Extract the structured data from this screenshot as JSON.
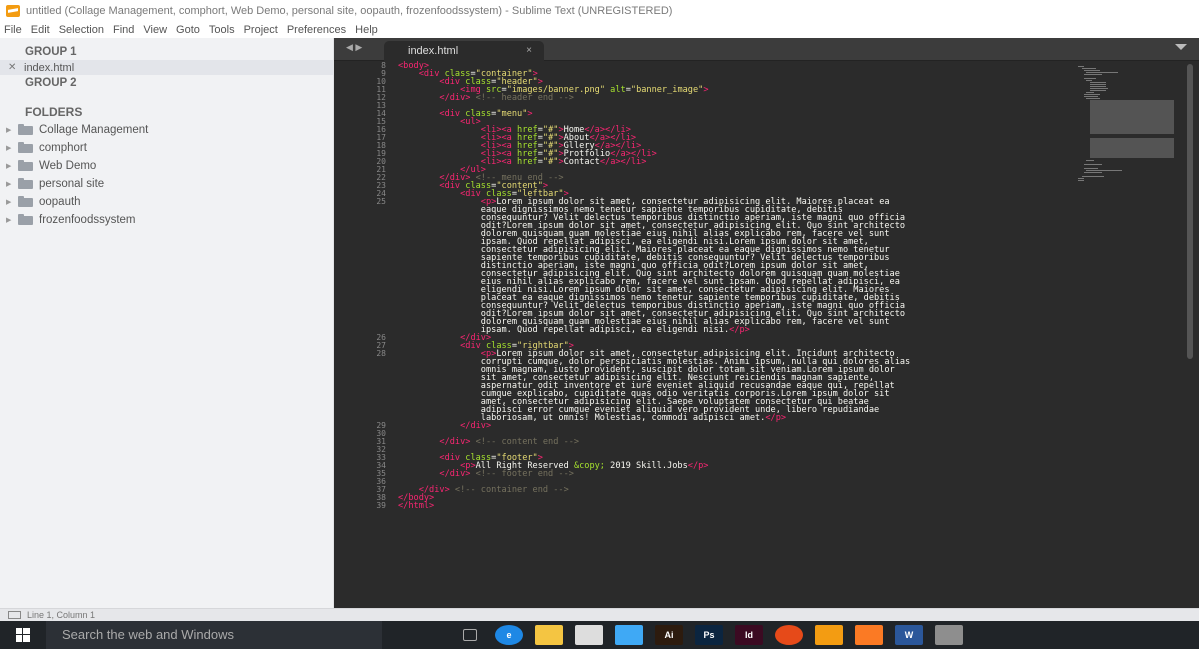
{
  "titlebar": {
    "text": "untitled (Collage Management, comphort, Web Demo, personal site, oopauth, frozenfoodssystem) - Sublime Text (UNREGISTERED)"
  },
  "menu": [
    "File",
    "Edit",
    "Selection",
    "Find",
    "View",
    "Goto",
    "Tools",
    "Project",
    "Preferences",
    "Help"
  ],
  "sidebar": {
    "group1": "GROUP 1",
    "open_file": "index.html",
    "group2": "GROUP 2",
    "folders_title": "FOLDERS",
    "folders": [
      "Collage Management",
      "comphort",
      "Web Demo",
      "personal site",
      "oopauth",
      "frozenfoodssystem"
    ]
  },
  "tab": {
    "nav": "◀ ▶",
    "title": "index.html",
    "close": "×"
  },
  "editor": {
    "lines": [
      {
        "n": "8",
        "t": [
          [
            "t",
            "<body>"
          ]
        ]
      },
      {
        "n": "9",
        "t": [
          [
            "p",
            "    "
          ],
          [
            "t",
            "<div"
          ],
          [
            "a",
            " class"
          ],
          [
            "p",
            "="
          ],
          [
            "s",
            "\"container\""
          ],
          [
            "t",
            ">"
          ]
        ]
      },
      {
        "n": "10",
        "t": [
          [
            "p",
            "        "
          ],
          [
            "t",
            "<div"
          ],
          [
            "a",
            " class"
          ],
          [
            "p",
            "="
          ],
          [
            "s",
            "\"header\""
          ],
          [
            "t",
            ">"
          ]
        ]
      },
      {
        "n": "11",
        "t": [
          [
            "p",
            "            "
          ],
          [
            "t",
            "<img"
          ],
          [
            "a",
            " src"
          ],
          [
            "p",
            "="
          ],
          [
            "s",
            "\"images/banner.png\""
          ],
          [
            "a",
            " alt"
          ],
          [
            "p",
            "="
          ],
          [
            "s",
            "\"banner_image\""
          ],
          [
            "t",
            ">"
          ]
        ]
      },
      {
        "n": "12",
        "t": [
          [
            "p",
            "        "
          ],
          [
            "t",
            "</div>"
          ],
          [
            "c",
            " <!-- header end -->"
          ]
        ]
      },
      {
        "n": "13",
        "t": []
      },
      {
        "n": "14",
        "t": [
          [
            "p",
            "        "
          ],
          [
            "t",
            "<div"
          ],
          [
            "a",
            " class"
          ],
          [
            "p",
            "="
          ],
          [
            "s",
            "\"menu\""
          ],
          [
            "t",
            ">"
          ]
        ]
      },
      {
        "n": "15",
        "t": [
          [
            "p",
            "            "
          ],
          [
            "t",
            "<ul>"
          ]
        ]
      },
      {
        "n": "16",
        "t": [
          [
            "p",
            "                "
          ],
          [
            "t",
            "<li><a"
          ],
          [
            "a",
            " href"
          ],
          [
            "p",
            "="
          ],
          [
            "s",
            "\"#\""
          ],
          [
            "t",
            ">"
          ],
          [
            "p",
            "Home"
          ],
          [
            "t",
            "</a></li>"
          ]
        ]
      },
      {
        "n": "17",
        "t": [
          [
            "p",
            "                "
          ],
          [
            "t",
            "<li><a"
          ],
          [
            "a",
            " href"
          ],
          [
            "p",
            "="
          ],
          [
            "s",
            "\"#\""
          ],
          [
            "t",
            ">"
          ],
          [
            "p",
            "About"
          ],
          [
            "t",
            "</a></li>"
          ]
        ]
      },
      {
        "n": "18",
        "t": [
          [
            "p",
            "                "
          ],
          [
            "t",
            "<li><a"
          ],
          [
            "a",
            " href"
          ],
          [
            "p",
            "="
          ],
          [
            "s",
            "\"#\""
          ],
          [
            "t",
            ">"
          ],
          [
            "p",
            "Gllery"
          ],
          [
            "t",
            "</a></li>"
          ]
        ]
      },
      {
        "n": "19",
        "t": [
          [
            "p",
            "                "
          ],
          [
            "t",
            "<li><a"
          ],
          [
            "a",
            " href"
          ],
          [
            "p",
            "="
          ],
          [
            "s",
            "\"#\""
          ],
          [
            "t",
            ">"
          ],
          [
            "p",
            "Protfolio"
          ],
          [
            "t",
            "</a></li>"
          ]
        ]
      },
      {
        "n": "20",
        "t": [
          [
            "p",
            "                "
          ],
          [
            "t",
            "<li><a"
          ],
          [
            "a",
            " href"
          ],
          [
            "p",
            "="
          ],
          [
            "s",
            "\"#\""
          ],
          [
            "t",
            ">"
          ],
          [
            "p",
            "Contact"
          ],
          [
            "t",
            "</a></li>"
          ]
        ]
      },
      {
        "n": "21",
        "t": [
          [
            "p",
            "            "
          ],
          [
            "t",
            "</ul>"
          ]
        ]
      },
      {
        "n": "22",
        "t": [
          [
            "p",
            "        "
          ],
          [
            "t",
            "</div>"
          ],
          [
            "c",
            " <!-- menu end -->"
          ]
        ]
      },
      {
        "n": "23",
        "t": [
          [
            "p",
            "        "
          ],
          [
            "t",
            "<div"
          ],
          [
            "a",
            " class"
          ],
          [
            "p",
            "="
          ],
          [
            "s",
            "\"content\""
          ],
          [
            "t",
            ">"
          ]
        ]
      },
      {
        "n": "24",
        "t": [
          [
            "p",
            "            "
          ],
          [
            "t",
            "<div"
          ],
          [
            "a",
            " class"
          ],
          [
            "p",
            "="
          ],
          [
            "s",
            "\"leftbar\""
          ],
          [
            "t",
            ">"
          ]
        ]
      },
      {
        "n": "25",
        "t": [
          [
            "p",
            "                "
          ],
          [
            "t",
            "<p>"
          ],
          [
            "p",
            "Lorem ipsum dolor sit amet, consectetur adipisicing elit. Maiores placeat ea"
          ]
        ]
      },
      {
        "n": "",
        "t": [
          [
            "p",
            "                eaque dignissimos nemo tenetur sapiente temporibus cupiditate, debitis"
          ]
        ]
      },
      {
        "n": "",
        "t": [
          [
            "p",
            "                consequuntur? Velit delectus temporibus distinctio aperiam, iste magni quo officia"
          ]
        ]
      },
      {
        "n": "",
        "t": [
          [
            "p",
            "                odit?Lorem ipsum dolor sit amet, consectetur adipisicing elit. Quo sint architecto"
          ]
        ]
      },
      {
        "n": "",
        "t": [
          [
            "p",
            "                dolorem quisquam quam molestiae eius nihil alias explicabo rem, facere vel sunt"
          ]
        ]
      },
      {
        "n": "",
        "t": [
          [
            "p",
            "                ipsam. Quod repellat adipisci, ea eligendi nisi.Lorem ipsum dolor sit amet,"
          ]
        ]
      },
      {
        "n": "",
        "t": [
          [
            "p",
            "                consectetur adipisicing elit. Maiores placeat ea eaque dignissimos nemo tenetur"
          ]
        ]
      },
      {
        "n": "",
        "t": [
          [
            "p",
            "                sapiente temporibus cupiditate, debitis consequuntur? Velit delectus temporibus"
          ]
        ]
      },
      {
        "n": "",
        "t": [
          [
            "p",
            "                distinctio aperiam, iste magni quo officia odit?Lorem ipsum dolor sit amet,"
          ]
        ]
      },
      {
        "n": "",
        "t": [
          [
            "p",
            "                consectetur adipisicing elit. Quo sint architecto dolorem quisquam quam molestiae"
          ]
        ]
      },
      {
        "n": "",
        "t": [
          [
            "p",
            "                eius nihil alias explicabo rem, facere vel sunt ipsam. Quod repellat adipisci, ea"
          ]
        ]
      },
      {
        "n": "",
        "t": [
          [
            "p",
            "                eligendi nisi.Lorem ipsum dolor sit amet, consectetur adipisicing elit. Maiores"
          ]
        ]
      },
      {
        "n": "",
        "t": [
          [
            "p",
            "                placeat ea eaque dignissimos nemo tenetur sapiente temporibus cupiditate, debitis"
          ]
        ]
      },
      {
        "n": "",
        "t": [
          [
            "p",
            "                consequuntur? Velit delectus temporibus distinctio aperiam, iste magni quo officia"
          ]
        ]
      },
      {
        "n": "",
        "t": [
          [
            "p",
            "                odit?Lorem ipsum dolor sit amet, consectetur adipisicing elit. Quo sint architecto"
          ]
        ]
      },
      {
        "n": "",
        "t": [
          [
            "p",
            "                dolorem quisquam quam molestiae eius nihil alias explicabo rem, facere vel sunt"
          ]
        ]
      },
      {
        "n": "",
        "t": [
          [
            "p",
            "                ipsam. Quod repellat adipisci, ea eligendi nisi."
          ],
          [
            "t",
            "</p>"
          ]
        ]
      },
      {
        "n": "26",
        "t": [
          [
            "p",
            "            "
          ],
          [
            "t",
            "</div>"
          ]
        ]
      },
      {
        "n": "27",
        "t": [
          [
            "p",
            "            "
          ],
          [
            "t",
            "<div"
          ],
          [
            "a",
            " class"
          ],
          [
            "p",
            "="
          ],
          [
            "s",
            "\"rightbar\""
          ],
          [
            "t",
            ">"
          ]
        ]
      },
      {
        "n": "28",
        "t": [
          [
            "p",
            "                "
          ],
          [
            "t",
            "<p>"
          ],
          [
            "p",
            "Lorem ipsum dolor sit amet, consectetur adipisicing elit. Incidunt architecto"
          ]
        ]
      },
      {
        "n": "",
        "t": [
          [
            "p",
            "                corrupti cumque, dolor perspiciatis molestias. Animi ipsum, nulla qui dolores alias"
          ]
        ]
      },
      {
        "n": "",
        "t": [
          [
            "p",
            "                omnis magnam, iusto provident, suscipit dolor totam sit veniam.Lorem ipsum dolor"
          ]
        ]
      },
      {
        "n": "",
        "t": [
          [
            "p",
            "                sit amet, consectetur adipisicing elit. Nesciunt reiciendis magnam sapiente,"
          ]
        ]
      },
      {
        "n": "",
        "t": [
          [
            "p",
            "                aspernatur odit inventore et iure eveniet aliquid recusandae eaque qui, repellat"
          ]
        ]
      },
      {
        "n": "",
        "t": [
          [
            "p",
            "                cumque explicabo, cupiditate quas odio veritatis corporis.Lorem ipsum dolor sit"
          ]
        ]
      },
      {
        "n": "",
        "t": [
          [
            "p",
            "                amet, consectetur adipisicing elit. Saepe voluptatem consectetur qui beatae"
          ]
        ]
      },
      {
        "n": "",
        "t": [
          [
            "p",
            "                adipisci error cumque eveniet aliquid vero provident unde, libero repudiandae"
          ]
        ]
      },
      {
        "n": "",
        "t": [
          [
            "p",
            "                laboriosam, ut omnis! Molestias, commodi adipisci amet."
          ],
          [
            "t",
            "</p>"
          ]
        ]
      },
      {
        "n": "29",
        "t": [
          [
            "p",
            "            "
          ],
          [
            "t",
            "</div>"
          ]
        ]
      },
      {
        "n": "30",
        "t": []
      },
      {
        "n": "31",
        "t": [
          [
            "p",
            "        "
          ],
          [
            "t",
            "</div>"
          ],
          [
            "c",
            " <!-- content end -->"
          ]
        ]
      },
      {
        "n": "32",
        "t": []
      },
      {
        "n": "33",
        "t": [
          [
            "p",
            "        "
          ],
          [
            "t",
            "<div"
          ],
          [
            "a",
            " class"
          ],
          [
            "p",
            "="
          ],
          [
            "s",
            "\"footer\""
          ],
          [
            "t",
            ">"
          ]
        ]
      },
      {
        "n": "34",
        "t": [
          [
            "p",
            "            "
          ],
          [
            "t",
            "<p>"
          ],
          [
            "p",
            "All Right Reserved "
          ],
          [
            "a",
            "&copy;"
          ],
          [
            "p",
            " 2019 Skill.Jobs"
          ],
          [
            "t",
            "</p>"
          ]
        ]
      },
      {
        "n": "35",
        "t": [
          [
            "p",
            "        "
          ],
          [
            "t",
            "</div>"
          ],
          [
            "c",
            " <!-- footer end -->"
          ]
        ]
      },
      {
        "n": "36",
        "t": []
      },
      {
        "n": "37",
        "t": [
          [
            "p",
            "    "
          ],
          [
            "t",
            "</div>"
          ],
          [
            "c",
            " <!-- container end -->"
          ]
        ]
      },
      {
        "n": "38",
        "t": [
          [
            "t",
            "</body>"
          ]
        ]
      },
      {
        "n": "39",
        "t": [
          [
            "t",
            "</html>"
          ]
        ]
      }
    ]
  },
  "statusbar": {
    "text": "Line 1, Column 1"
  },
  "taskbar": {
    "search_placeholder": "Search the web and Windows",
    "icons": [
      {
        "name": "task-view-icon",
        "label": "",
        "color": "#202428"
      },
      {
        "name": "edge-icon",
        "label": "e",
        "color": "#1e88e5"
      },
      {
        "name": "file-explorer-icon",
        "label": "",
        "color": "#f4c542"
      },
      {
        "name": "store-icon",
        "label": "",
        "color": "#dddddd"
      },
      {
        "name": "media-icon",
        "label": "",
        "color": "#3fa9f5"
      },
      {
        "name": "illustrator-icon",
        "label": "Ai",
        "color": "#2d1b0e"
      },
      {
        "name": "photoshop-icon",
        "label": "Ps",
        "color": "#0b2540"
      },
      {
        "name": "indesign-icon",
        "label": "Id",
        "color": "#3b0a22"
      },
      {
        "name": "chrome-icon",
        "label": "",
        "color": "#e64a19"
      },
      {
        "name": "sublime-icon",
        "label": "",
        "color": "#f39c12"
      },
      {
        "name": "xampp-icon",
        "label": "",
        "color": "#fb7a24"
      },
      {
        "name": "word-icon",
        "label": "W",
        "color": "#2b579a"
      },
      {
        "name": "gimp-icon",
        "label": "",
        "color": "#8e8e8e"
      }
    ]
  },
  "colors": {
    "tag": "#f92672",
    "attr": "#a6e22e",
    "string": "#e6db74",
    "comment": "#75715e",
    "text": "#f8f8f2",
    "editor_bg": "#2b2b2b"
  }
}
